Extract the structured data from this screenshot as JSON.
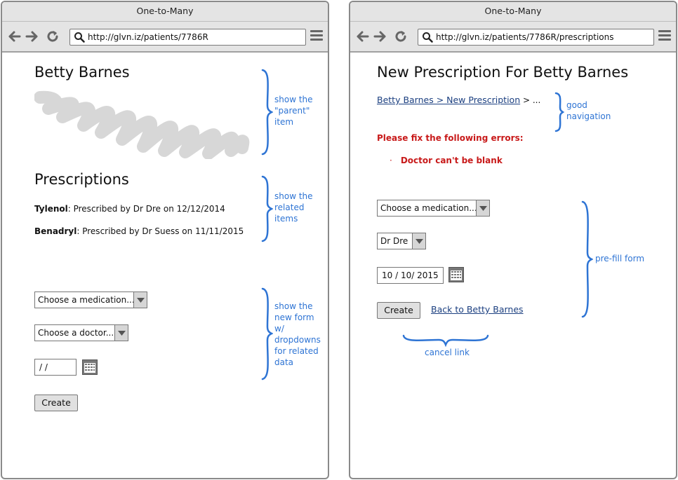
{
  "left_window": {
    "title": "One-to-Many",
    "url": "http://glvn.iz/patients/7786R",
    "patient_name": "Betty Barnes",
    "prescriptions_heading": "Prescriptions",
    "prescriptions": [
      {
        "drug": "Tylenol",
        "rest": ": Prescribed by Dr Dre on 12/12/2014"
      },
      {
        "drug": "Benadryl",
        "rest": ": Prescribed by Dr Suess on 11/11/2015"
      }
    ],
    "form": {
      "medication_select": "Choose a medication...",
      "doctor_select": "Choose a doctor...",
      "date_value": "/ /",
      "create_button": "Create"
    },
    "annotations": {
      "parent": [
        "show the",
        "\"parent\"",
        "item"
      ],
      "related": [
        "show the",
        "related",
        "items"
      ],
      "form": [
        "show the",
        "new form",
        "w/",
        "dropdowns",
        "for related",
        "data"
      ]
    }
  },
  "right_window": {
    "title": "One-to-Many",
    "url": "http://glvn.iz/patients/7786R/prescriptions",
    "heading": "New Prescription For Betty Barnes",
    "breadcrumb_link": "Betty Barnes > New Prescription",
    "breadcrumb_rest": " > ...",
    "error_heading": "Please fix the following errors:",
    "errors": [
      "Doctor can't be blank"
    ],
    "form": {
      "medication_select": "Choose a medication...",
      "doctor_select": "Dr Dre",
      "date_value": "10 / 10/ 2015",
      "create_button": "Create",
      "back_link": "Back to Betty Barnes"
    },
    "annotations": {
      "navigation": [
        "good",
        "navigation"
      ],
      "prefill": [
        "pre-fill form"
      ],
      "cancel": [
        "cancel link"
      ]
    }
  },
  "colors": {
    "annotation": "#2e74d4",
    "error": "#c81a1a",
    "link": "#1b3f80",
    "chrome": "#e4e4e4"
  },
  "icons": [
    "back-arrow-icon",
    "forward-arrow-icon",
    "reload-icon",
    "search-icon",
    "hamburger-menu-icon",
    "calendar-icon",
    "dropdown-arrow-icon",
    "brace-icon"
  ]
}
